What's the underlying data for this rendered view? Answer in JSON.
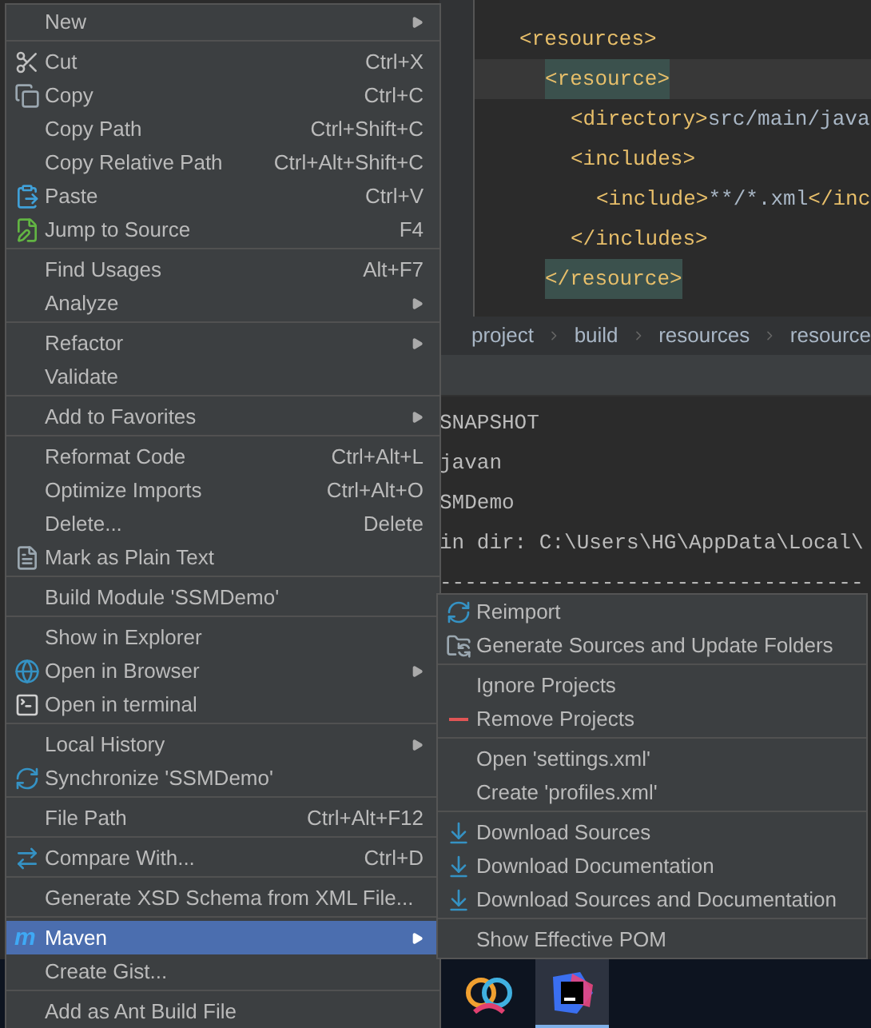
{
  "editor": {
    "code": [
      {
        "tag": "<resources>",
        "children": [
          {
            "tag": "<resource>",
            "highlighted": true,
            "current_line": true,
            "children": [
              {
                "tag": "<directory>",
                "text": "src/main/java"
              },
              {
                "tag": "<includes>",
                "children": [
                  {
                    "tag": "<include>",
                    "text": "**/*.xml",
                    "close_tag": "</inc"
                  }
                ]
              },
              {
                "tag": "</includes>"
              }
            ]
          },
          {
            "tag": "</resource>",
            "highlighted": true,
            "current_line": false
          }
        ]
      }
    ],
    "breadcrumbs": [
      "project",
      "build",
      "resources",
      "resource"
    ]
  },
  "console": {
    "lines": [
      "SNAPSHOT",
      "javan",
      "SMDemo",
      "in dir: C:\\Users\\HG\\AppData\\Local\\",
      "----------------------------------"
    ]
  },
  "context_menu": {
    "groups": [
      [
        {
          "label": "New",
          "has_submenu": true,
          "selected": false
        }
      ],
      [
        {
          "label": "Cut",
          "shortcut": "Ctrl+X",
          "has_submenu": false,
          "selected": false
        },
        {
          "label": "Copy",
          "shortcut": "Ctrl+C",
          "has_submenu": false,
          "selected": false
        },
        {
          "label": "Copy Path",
          "shortcut": "Ctrl+Shift+C",
          "has_submenu": false,
          "selected": false
        },
        {
          "label": "Copy Relative Path",
          "shortcut": "Ctrl+Alt+Shift+C",
          "has_submenu": false,
          "selected": false
        },
        {
          "label": "Paste",
          "shortcut": "Ctrl+V",
          "has_submenu": false,
          "selected": false
        },
        {
          "label": "Jump to Source",
          "shortcut": "F4",
          "has_submenu": false,
          "selected": false
        }
      ],
      [
        {
          "label": "Find Usages",
          "shortcut": "Alt+F7",
          "has_submenu": false,
          "selected": false
        },
        {
          "label": "Analyze",
          "has_submenu": true,
          "selected": false
        }
      ],
      [
        {
          "label": "Refactor",
          "has_submenu": true,
          "selected": false
        },
        {
          "label": "Validate",
          "has_submenu": false,
          "selected": false
        }
      ],
      [
        {
          "label": "Add to Favorites",
          "has_submenu": true,
          "selected": false
        }
      ],
      [
        {
          "label": "Reformat Code",
          "shortcut": "Ctrl+Alt+L",
          "has_submenu": false,
          "selected": false
        },
        {
          "label": "Optimize Imports",
          "shortcut": "Ctrl+Alt+O",
          "has_submenu": false,
          "selected": false
        },
        {
          "label": "Delete...",
          "shortcut": "Delete",
          "has_submenu": false,
          "selected": false
        },
        {
          "label": "Mark as Plain Text",
          "has_submenu": false,
          "selected": false
        }
      ],
      [
        {
          "label": "Build Module 'SSMDemo'",
          "has_submenu": false,
          "selected": false
        }
      ],
      [
        {
          "label": "Show in Explorer",
          "has_submenu": false,
          "selected": false
        },
        {
          "label": "Open in Browser",
          "has_submenu": true,
          "selected": false
        },
        {
          "label": "Open in terminal",
          "has_submenu": false,
          "selected": false
        }
      ],
      [
        {
          "label": "Local History",
          "has_submenu": true,
          "selected": false
        },
        {
          "label": "Synchronize 'SSMDemo'",
          "has_submenu": false,
          "selected": false
        }
      ],
      [
        {
          "label": "File Path",
          "shortcut": "Ctrl+Alt+F12",
          "has_submenu": false,
          "selected": false
        }
      ],
      [
        {
          "label": "Compare With...",
          "shortcut": "Ctrl+D",
          "has_submenu": false,
          "selected": false
        }
      ],
      [
        {
          "label": "Generate XSD Schema from XML File...",
          "has_submenu": false,
          "selected": false
        }
      ],
      [
        {
          "label": "Maven",
          "icon_text": "m",
          "has_submenu": true,
          "selected": true
        },
        {
          "label": "Create Gist...",
          "has_submenu": false,
          "selected": false
        }
      ],
      [
        {
          "label": "Add as Ant Build File",
          "has_submenu": false,
          "selected": false
        }
      ]
    ]
  },
  "submenu": {
    "groups": [
      [
        {
          "label": "Reimport"
        },
        {
          "label": "Generate Sources and Update Folders"
        }
      ],
      [
        {
          "label": "Ignore Projects"
        },
        {
          "label": "Remove Projects"
        }
      ],
      [
        {
          "label": "Open 'settings.xml'"
        },
        {
          "label": "Create 'profiles.xml'"
        }
      ],
      [
        {
          "label": "Download Sources"
        },
        {
          "label": "Download Documentation"
        },
        {
          "label": "Download Sources and Documentation"
        }
      ],
      [
        {
          "label": "Show Effective POM"
        }
      ]
    ]
  },
  "taskbar": {
    "apps": [
      {
        "selected": false
      },
      {
        "selected": true
      }
    ]
  }
}
